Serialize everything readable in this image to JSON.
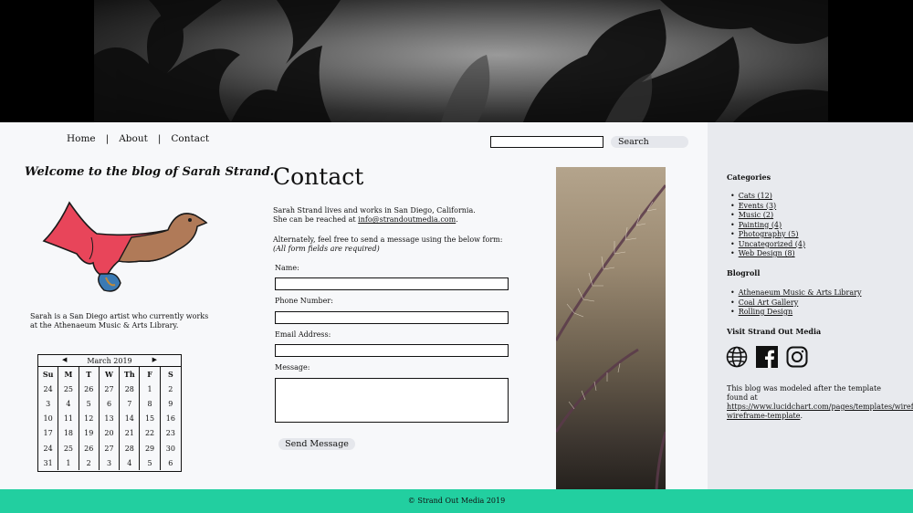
{
  "nav": {
    "items": [
      "Home",
      "About",
      "Contact"
    ],
    "separator": "|"
  },
  "search": {
    "button_label": "Search",
    "value": ""
  },
  "left": {
    "welcome": "Welcome to the blog of Sarah Strand.",
    "bio": "Sarah is a San Diego artist who currently works at the Athenaeum Music & Arts Library.",
    "calendar": {
      "month": "March 2019",
      "prev": "◀",
      "next": "▶",
      "days": [
        "Su",
        "M",
        "T",
        "W",
        "Th",
        "F",
        "S"
      ],
      "weeks": [
        [
          "24",
          "25",
          "26",
          "27",
          "28",
          "1",
          "2"
        ],
        [
          "3",
          "4",
          "5",
          "6",
          "7",
          "8",
          "9"
        ],
        [
          "10",
          "11",
          "12",
          "13",
          "14",
          "15",
          "16"
        ],
        [
          "17",
          "18",
          "19",
          "20",
          "21",
          "22",
          "23"
        ],
        [
          "24",
          "25",
          "26",
          "27",
          "28",
          "29",
          "30"
        ],
        [
          "31",
          "1",
          "2",
          "3",
          "4",
          "5",
          "6"
        ]
      ]
    }
  },
  "main": {
    "title": "Contact",
    "intro_line1": "Sarah Strand lives and works in San Diego, California.",
    "intro_line2_prefix": "She can be reached at ",
    "email": "info@strandoutmedia.com",
    "intro_line2_suffix": ".",
    "form_intro": "Alternately, feel free to send a message using the below form:",
    "form_required": "(All form fields are required)",
    "fields": {
      "name": "Name:",
      "phone": "Phone Number:",
      "email": "Email Address:",
      "message": "Message:"
    },
    "send_label": "Send Message"
  },
  "sidebar": {
    "categories_title": "Categories",
    "categories": [
      "Cats (12)",
      "Events (3)",
      "Music (2)",
      "Painting (4)",
      "Photography (5)",
      "Uncategorized (4)",
      "Web Design (8)"
    ],
    "blogroll_title": "Blogroll",
    "blogroll": [
      "Athenaeum Music & Arts Library",
      "Coal Art Gallery",
      "Rolling Design"
    ],
    "visit_title": "Visit Strand Out Media",
    "social_icons": [
      "globe-icon",
      "facebook-icon",
      "instagram-icon"
    ],
    "note_prefix": "This blog was modeled after the template found at ",
    "note_link": "https://www.lucidchart.com/pages/templates/wireframe/blog-wireframe-template",
    "note_suffix": "."
  },
  "footer": {
    "text": "© Strand Out Media 2019"
  },
  "colors": {
    "footer": "#22cfa0",
    "sidebar": "#e8eaee",
    "button": "#e5e7ec"
  }
}
